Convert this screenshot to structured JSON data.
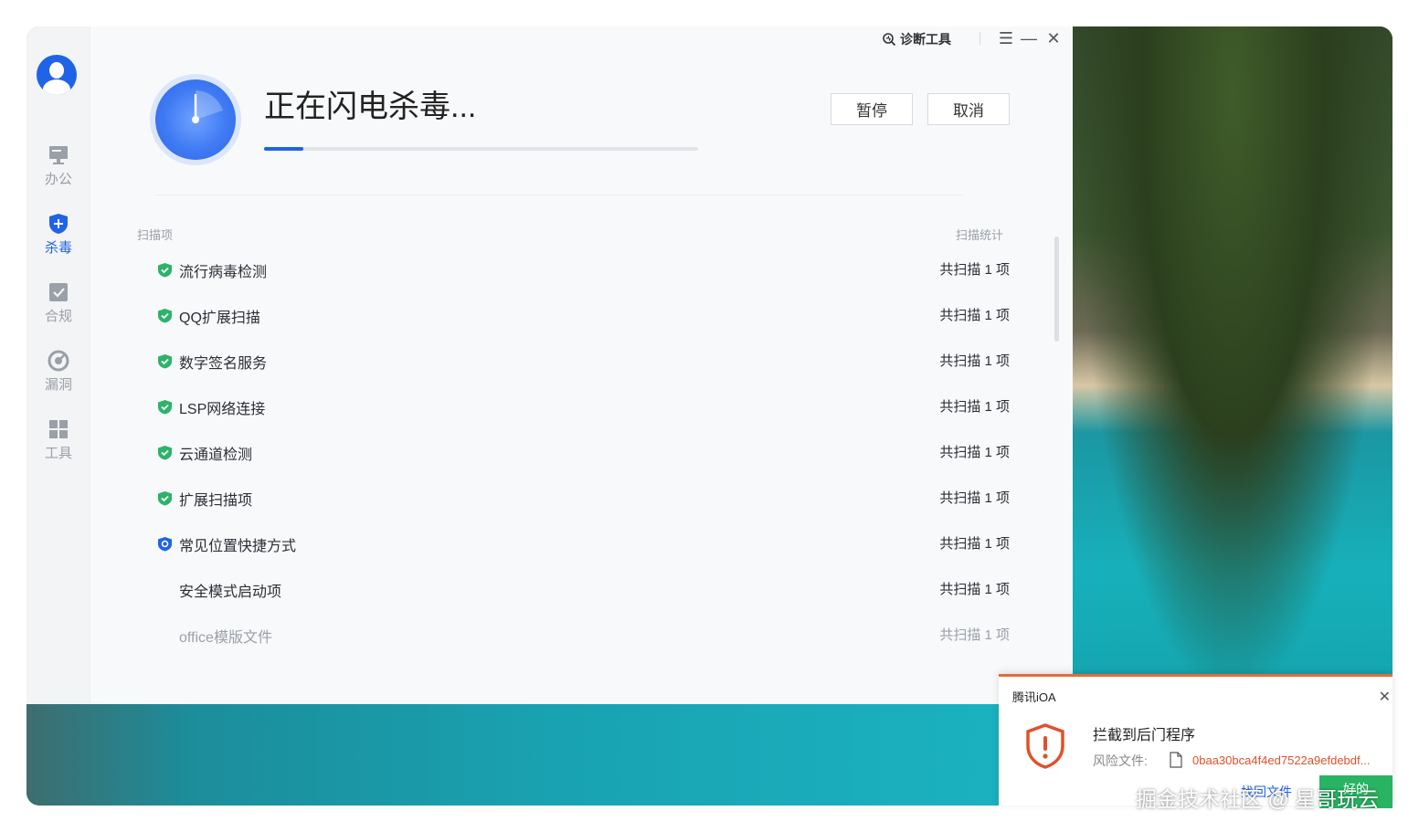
{
  "titlebar": {
    "diagnose_label": "诊断工具"
  },
  "rail": {
    "items": [
      {
        "label": "办公",
        "icon": "monitor-icon"
      },
      {
        "label": "杀毒",
        "icon": "shield-plus-icon",
        "active": true
      },
      {
        "label": "合规",
        "icon": "check-box-icon"
      },
      {
        "label": "漏洞",
        "icon": "radar-icon"
      },
      {
        "label": "工具",
        "icon": "grid-icon"
      }
    ]
  },
  "scan": {
    "title": "正在闪电杀毒...",
    "progress": 0.09,
    "pause_label": "暂停",
    "cancel_label": "取消",
    "col_item": "扫描项",
    "col_stat": "扫描统计",
    "rows": [
      {
        "name": "流行病毒检测",
        "stat": "共扫描 1 项",
        "status": "done"
      },
      {
        "name": "QQ扩展扫描",
        "stat": "共扫描 1 项",
        "status": "done"
      },
      {
        "name": "数字签名服务",
        "stat": "共扫描 1 项",
        "status": "done"
      },
      {
        "name": "LSP网络连接",
        "stat": "共扫描 1 项",
        "status": "done"
      },
      {
        "name": "云通道检测",
        "stat": "共扫描 1 项",
        "status": "done"
      },
      {
        "name": "扩展扫描项",
        "stat": "共扫描 1 项",
        "status": "done"
      },
      {
        "name": "常见位置快捷方式",
        "stat": "共扫描 1 项",
        "status": "scanning"
      },
      {
        "name": "安全模式启动项",
        "stat": "共扫描 1 项",
        "status": "sub"
      },
      {
        "name": "office模版文件",
        "stat": "共扫描 1 项",
        "status": "sub-dim"
      }
    ]
  },
  "toast": {
    "brand": "腾讯iOA",
    "headline": "拦截到后门程序",
    "risk_label": "风险文件:",
    "file_name": "0baa30bca4f4ed7522a9efdebdf...",
    "action_secondary": "找回文件",
    "action_primary": "好的"
  },
  "watermark": "掘金技术社区 @ 星哥玩云",
  "colors": {
    "accent": "#1f63e6",
    "ok": "#2db36a",
    "danger": "#e0512a"
  }
}
